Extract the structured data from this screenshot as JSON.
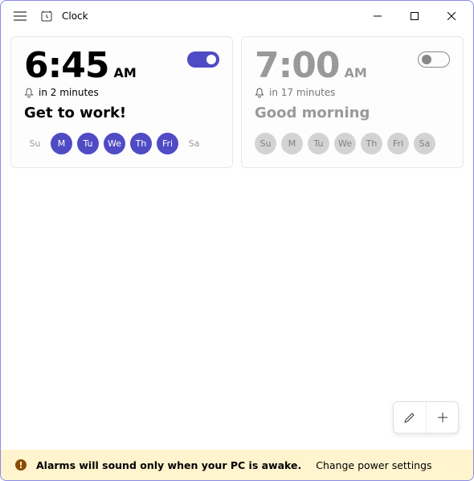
{
  "titlebar": {
    "title": "Clock"
  },
  "alarms": [
    {
      "time": "6:45",
      "ampm": "AM",
      "status": "in 2 minutes",
      "label": "Get to work!",
      "enabled": true,
      "days": [
        {
          "abbr": "Su",
          "selected": false
        },
        {
          "abbr": "M",
          "selected": true
        },
        {
          "abbr": "Tu",
          "selected": true
        },
        {
          "abbr": "We",
          "selected": true
        },
        {
          "abbr": "Th",
          "selected": true
        },
        {
          "abbr": "Fri",
          "selected": true
        },
        {
          "abbr": "Sa",
          "selected": false
        }
      ]
    },
    {
      "time": "7:00",
      "ampm": "AM",
      "status": "in 17 minutes",
      "label": "Good morning",
      "enabled": false,
      "days": [
        {
          "abbr": "Su",
          "selected": true
        },
        {
          "abbr": "M",
          "selected": true
        },
        {
          "abbr": "Tu",
          "selected": true
        },
        {
          "abbr": "We",
          "selected": true
        },
        {
          "abbr": "Th",
          "selected": true
        },
        {
          "abbr": "Fri",
          "selected": true
        },
        {
          "abbr": "Sa",
          "selected": true
        }
      ]
    }
  ],
  "infobar": {
    "message": "Alarms will sound only when your PC is awake.",
    "link": "Change power settings"
  },
  "colors": {
    "accent": "#4f4bc4",
    "info_bg": "#fff4ce",
    "info_icon": "#8a4b00"
  }
}
